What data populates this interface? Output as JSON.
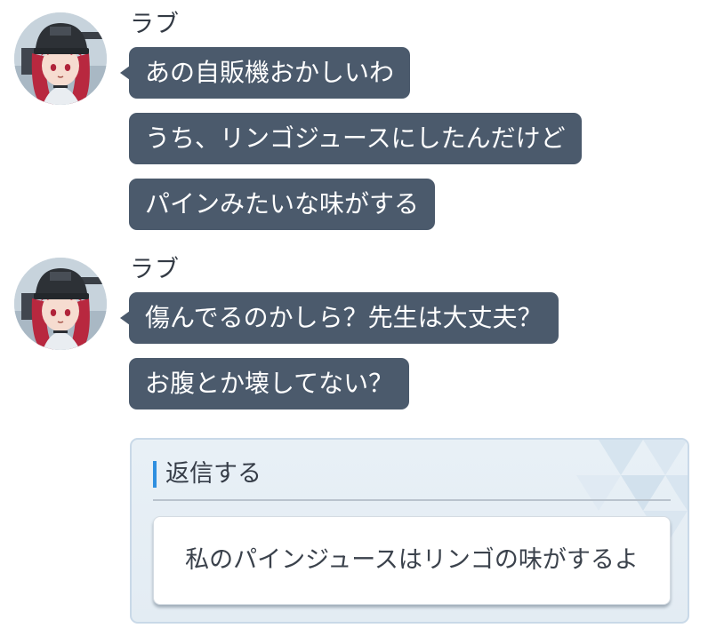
{
  "messages": [
    {
      "sender": "ラブ",
      "avatar_icon": "student-avatar-icon",
      "bubbles": [
        "あの自販機おかしいわ",
        "うち、リンゴジュースにしたんだけど",
        "パインみたいな味がする"
      ]
    },
    {
      "sender": "ラブ",
      "avatar_icon": "student-avatar-icon",
      "bubbles": [
        "傷んでるのかしら？先生は大丈夫？",
        "お腹とか壊してない？"
      ]
    }
  ],
  "reply": {
    "title": "返信する",
    "option": "私のパインジュースはリンゴの味がするよ"
  },
  "colors": {
    "bubble": "#4b5a6c",
    "accent": "#2f8fe0",
    "reply_bg": "#e6eef5"
  }
}
